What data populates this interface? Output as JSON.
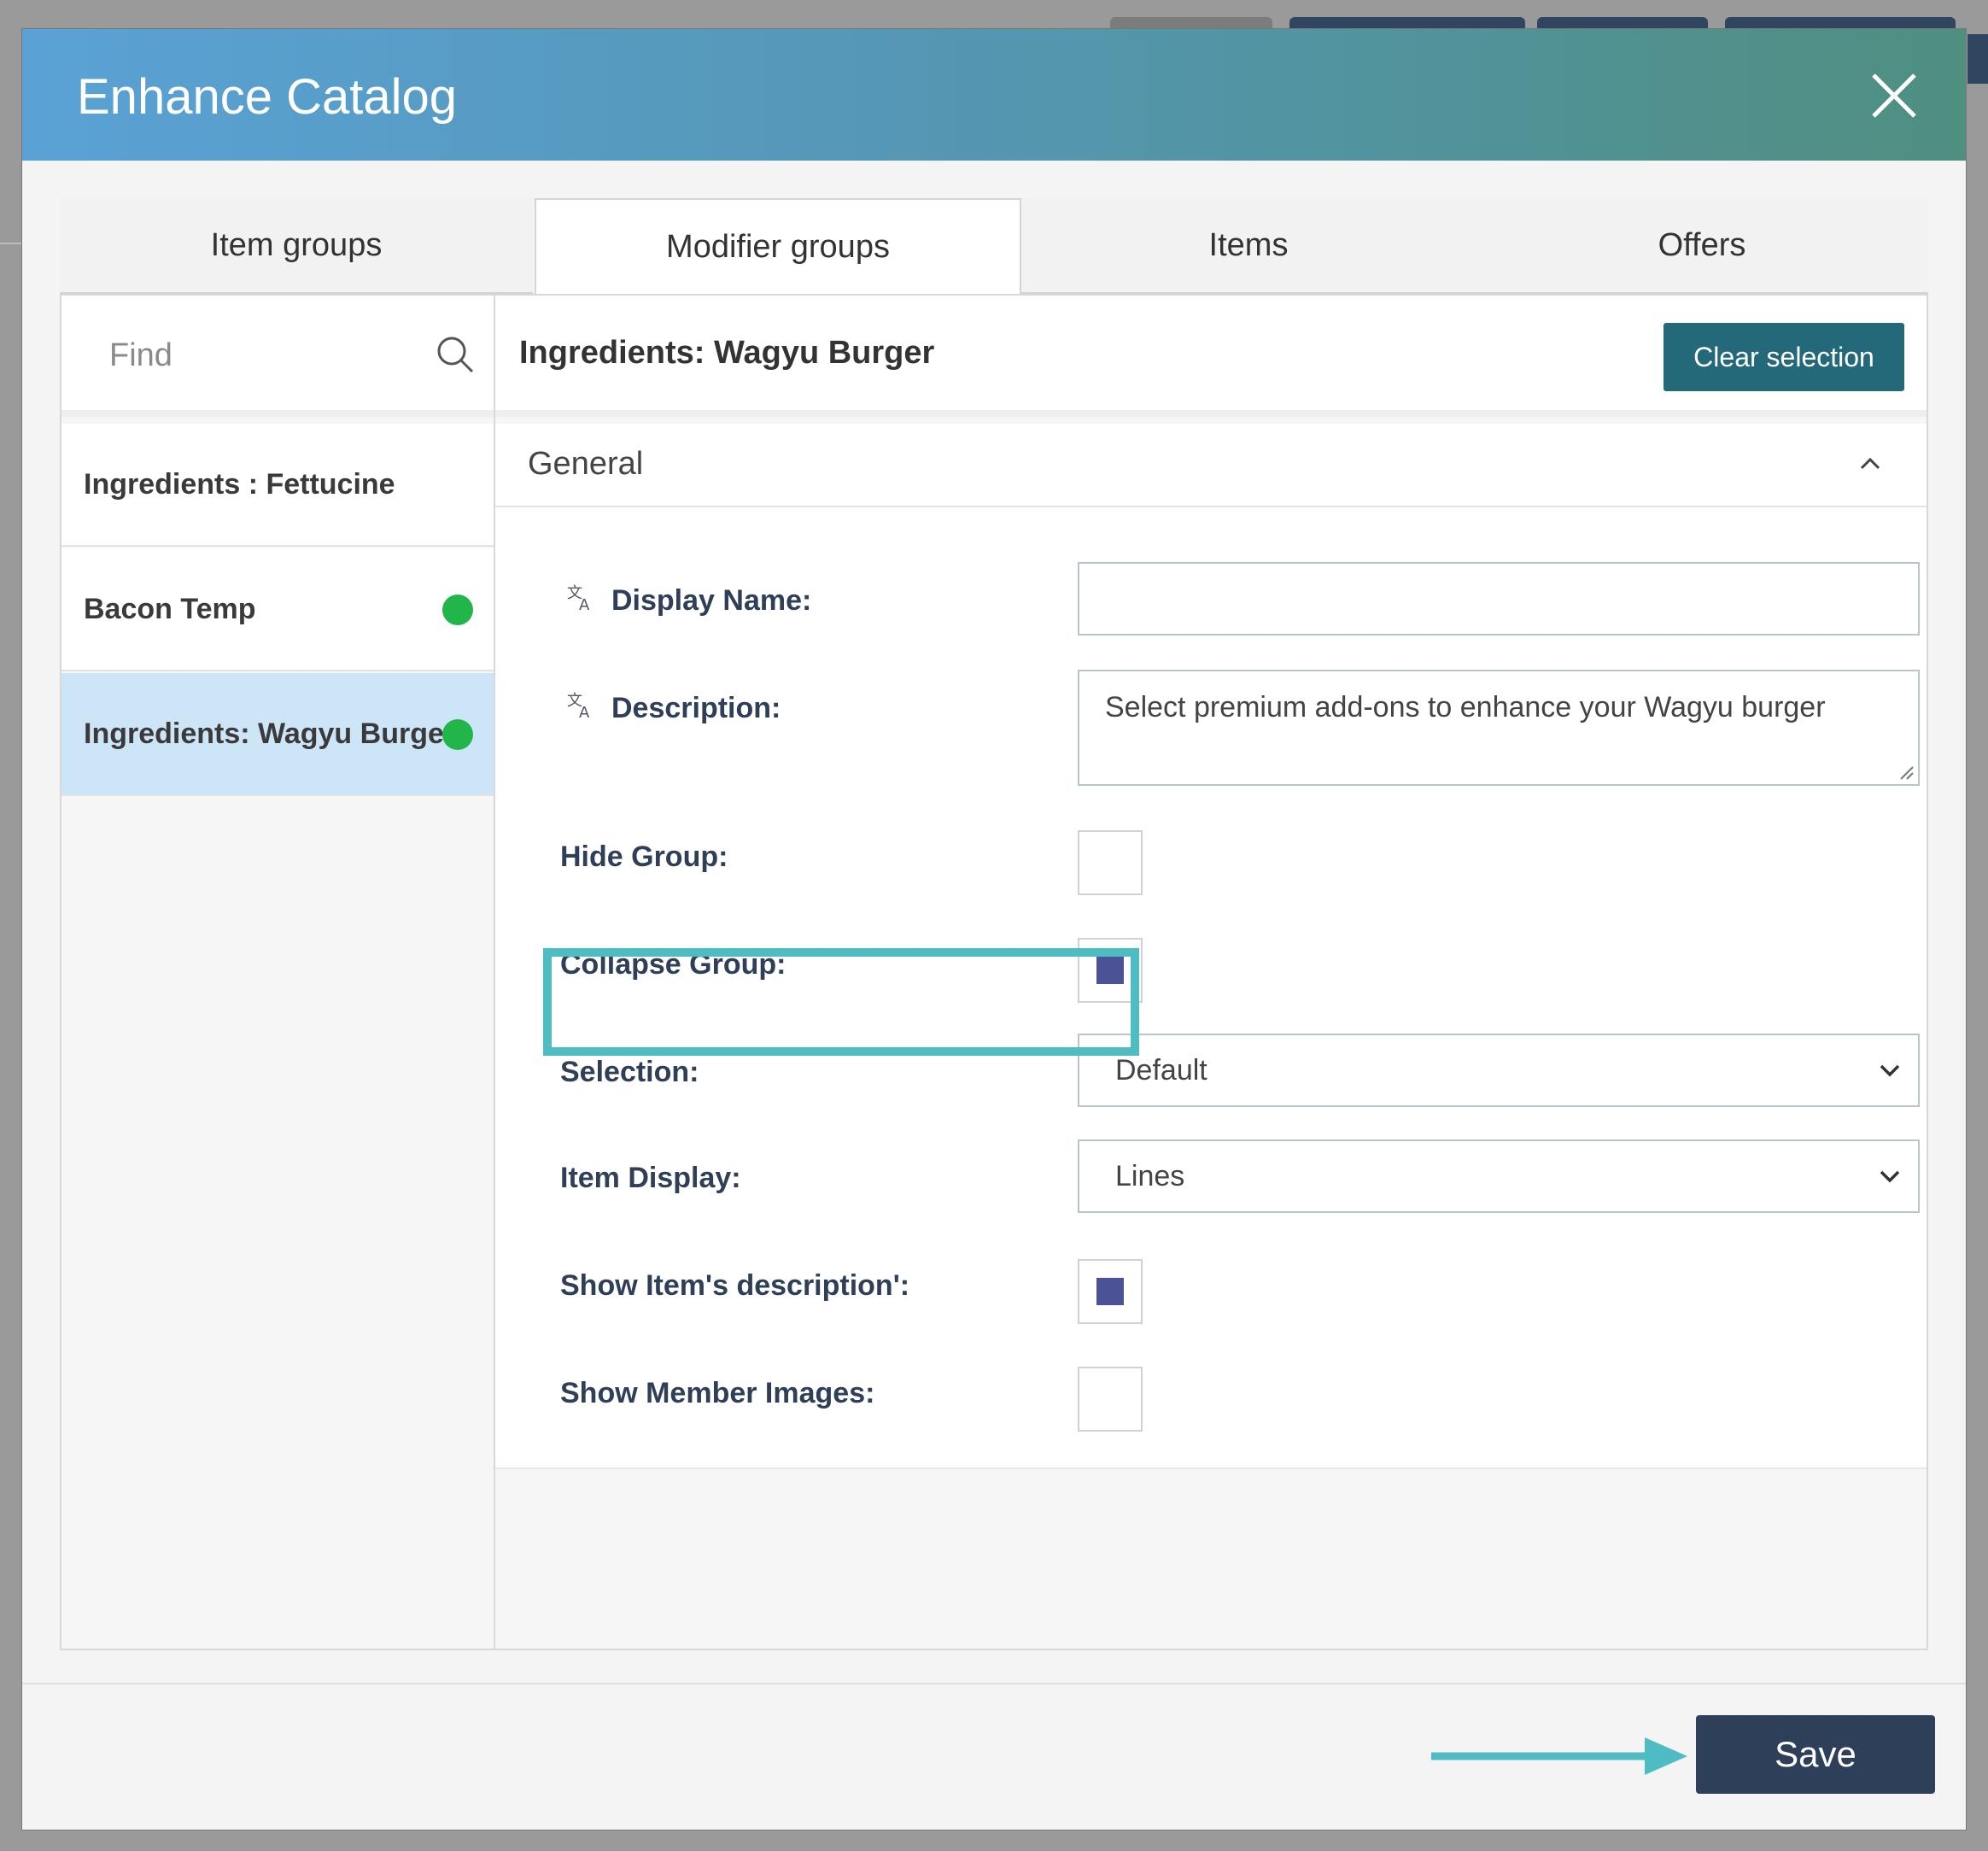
{
  "dialog": {
    "title": "Enhance Catalog",
    "close_icon": "close-icon"
  },
  "tabs": [
    {
      "label": "Item groups",
      "active": false
    },
    {
      "label": "Modifier groups",
      "active": true
    },
    {
      "label": "Items",
      "active": false
    },
    {
      "label": "Offers",
      "active": false
    }
  ],
  "search": {
    "placeholder": "Find",
    "icon": "search-icon"
  },
  "list": [
    {
      "label": "Ingredients : Fettucine",
      "status_dot": false,
      "selected": false
    },
    {
      "label": "Bacon Temp",
      "status_dot": true,
      "selected": false
    },
    {
      "label": "Ingredients: Wagyu Burger",
      "status_dot": true,
      "selected": true
    }
  ],
  "detail": {
    "title": "Ingredients: Wagyu Burger",
    "clear_label": "Clear selection",
    "section": "General",
    "fields": {
      "display_name_label": "Display Name:",
      "display_name_value": "",
      "description_label": "Description:",
      "description_value": "Select premium add-ons to enhance your Wagyu burger",
      "hide_group_label": "Hide Group:",
      "hide_group_checked": false,
      "collapse_group_label": "Collapse Group:",
      "collapse_group_checked": true,
      "selection_label": "Selection:",
      "selection_value": "Default",
      "item_display_label": "Item Display:",
      "item_display_value": "Lines",
      "show_description_label": "Show Item's description':",
      "show_description_checked": true,
      "show_images_label": "Show Member Images:",
      "show_images_checked": false
    }
  },
  "footer": {
    "save_label": "Save"
  },
  "colors": {
    "header_start": "#5aa2d6",
    "header_end": "#4e8f80",
    "clear_button": "#23697a",
    "save_button": "#2e3f5a",
    "highlight": "#4fbcc3",
    "status_dot": "#22b64a",
    "check_fill": "#4b5396",
    "selected_row": "#cce6f8"
  }
}
